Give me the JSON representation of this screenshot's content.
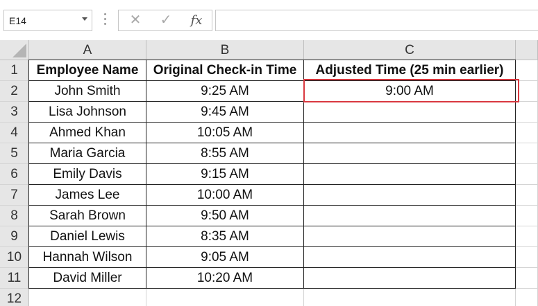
{
  "formula_bar": {
    "name_box": "E14",
    "cancel_icon": "✕",
    "enter_icon": "✓",
    "fx_label": "fx",
    "formula": ""
  },
  "columns": [
    "A",
    "B",
    "C"
  ],
  "rows": [
    "1",
    "2",
    "3",
    "4",
    "5",
    "6",
    "7",
    "8",
    "9",
    "10",
    "11",
    "12"
  ],
  "table": {
    "headers": [
      "Employee Name",
      "Original Check-in Time",
      "Adjusted Time (25 min earlier)"
    ],
    "data": [
      [
        "John Smith",
        "9:25 AM",
        "9:00 AM"
      ],
      [
        "Lisa Johnson",
        "9:45 AM",
        ""
      ],
      [
        "Ahmed Khan",
        "10:05 AM",
        ""
      ],
      [
        "Maria Garcia",
        "8:55 AM",
        ""
      ],
      [
        "Emily Davis",
        "9:15 AM",
        ""
      ],
      [
        "James Lee",
        "10:00 AM",
        ""
      ],
      [
        "Sarah Brown",
        "9:50 AM",
        ""
      ],
      [
        "Daniel Lewis",
        "8:35 AM",
        ""
      ],
      [
        "Hannah Wilson",
        "9:05 AM",
        ""
      ],
      [
        "David Miller",
        "10:20 AM",
        ""
      ]
    ]
  },
  "colors": {
    "highlight_border": "#d9383f",
    "header_bg": "#e6e6e6"
  }
}
